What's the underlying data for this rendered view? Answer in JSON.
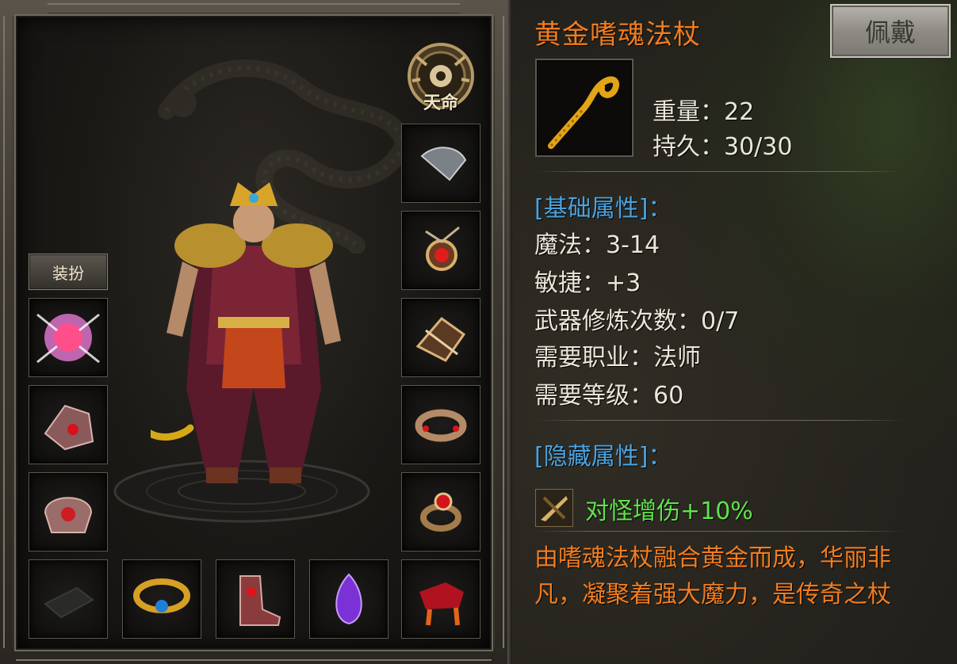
{
  "equipment_panel": {
    "emblem_label": "天命",
    "outfit_button": "装扮",
    "left_slots": [
      {
        "icon": "pink-orb-medal-icon"
      },
      {
        "icon": "bracer-icon"
      },
      {
        "icon": "helmet-emblem-icon"
      },
      {
        "icon": "empty-book-slot-icon"
      }
    ],
    "right_slots": [
      {
        "icon": "wing-umbrella-icon"
      },
      {
        "icon": "necklace-amulet-icon"
      },
      {
        "icon": "bracelet-claw-icon"
      },
      {
        "icon": "ring-band-icon"
      },
      {
        "icon": "ruby-ring-icon"
      },
      {
        "icon": "mount-horse-icon"
      }
    ],
    "bottom_slots": [
      {
        "icon": "gold-belt-icon"
      },
      {
        "icon": "boots-icon"
      },
      {
        "icon": "purple-gem-icon"
      }
    ]
  },
  "item_detail": {
    "name": "黄金嗜魂法杖",
    "equip_button": "佩戴",
    "icon": "golden-staff-icon",
    "weight": "重量：22",
    "durability": "持久：30/30",
    "basic_header": "[基础属性]：",
    "basic_attrs": [
      "魔法：3-14",
      "敏捷：+3",
      "武器修炼次数：0/7",
      "需要职业：法师",
      "需要等级：60"
    ],
    "hidden_header": "[隐藏属性]：",
    "hidden_attr_icon": "monster-damage-icon",
    "hidden_attr": "对怪增伤+10%",
    "description": "由嗜魂法杖融合黄金而成，华丽非凡，凝聚着强大魔力，是传奇之杖"
  },
  "colors": {
    "item_name": "#f07d21",
    "section_header": "#4aa3e0",
    "hidden_attr": "#5fe34a",
    "stat_text": "#ebe6da"
  }
}
